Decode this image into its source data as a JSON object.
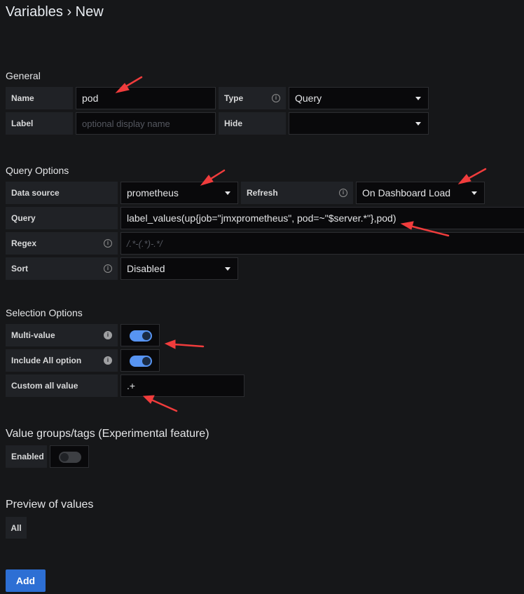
{
  "header": {
    "title": "Variables › New"
  },
  "general": {
    "section_title": "General",
    "name_label": "Name",
    "name_value": "pod",
    "type_label": "Type",
    "type_value": "Query",
    "label_label": "Label",
    "label_placeholder": "optional display name",
    "hide_label": "Hide",
    "hide_value": ""
  },
  "query_options": {
    "section_title": "Query Options",
    "datasource_label": "Data source",
    "datasource_value": "prometheus",
    "refresh_label": "Refresh",
    "refresh_value": "On Dashboard Load",
    "query_label": "Query",
    "query_value": "label_values(up{job=\"jmxprometheus\", pod=~\"$server.*\"},pod)",
    "regex_label": "Regex",
    "regex_placeholder": "/.*-(.*)-.*/",
    "sort_label": "Sort",
    "sort_value": "Disabled"
  },
  "selection_options": {
    "section_title": "Selection Options",
    "multi_value_label": "Multi-value",
    "multi_value_on": true,
    "include_all_label": "Include All option",
    "include_all_on": true,
    "custom_all_label": "Custom all value",
    "custom_all_value": ".+"
  },
  "value_groups": {
    "section_title": "Value groups/tags (Experimental feature)",
    "enabled_label": "Enabled",
    "enabled_on": false
  },
  "preview": {
    "section_title": "Preview of values",
    "values": [
      "All"
    ]
  },
  "actions": {
    "add_label": "Add"
  },
  "colors": {
    "background": "#161719",
    "accent": "#5794f2",
    "button": "#2d6fd4",
    "annotation": "#f03c3c"
  },
  "icons": {
    "info": "info-icon",
    "caret": "caret-down-icon"
  }
}
